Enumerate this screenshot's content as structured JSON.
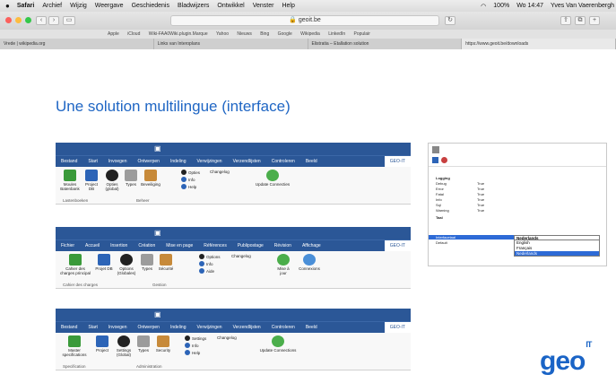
{
  "menubar": {
    "apple": "",
    "items": [
      "Safari",
      "Archief",
      "Wijzig",
      "Weergave",
      "Geschiedenis",
      "Bladwijzers",
      "Ontwikkel",
      "Venster",
      "Help"
    ],
    "status": "100%",
    "clock": "Wo 14:47",
    "user": "Yves Van Vaerenbergh"
  },
  "browser": {
    "address": "🔒 geoit.be",
    "favorites": [
      "Apple",
      "iCloud",
      "Wiki-FAA0Wiki.plugin.Marque",
      "Yahoo",
      "Nieuws",
      "Bing",
      "Google",
      "Wikipedia",
      "LinkedIn",
      "Populair"
    ],
    "tabs": [
      "Vrede | wikipedia.org",
      "Links van Interoplans",
      "Elistratia – Etallation solution",
      "https://www.geoit.be/downloads"
    ]
  },
  "slide": {
    "title": "Une solution multilingue (interface)"
  },
  "ribbons": [
    {
      "tabs": [
        "Bestand",
        "Start",
        "Invoegen",
        "Ontwerpen",
        "Indeling",
        "Verwijzingen",
        "Verzendlijsten",
        "Controleren",
        "Beeld",
        "GEO-IT"
      ],
      "buttons": [
        "Moules Batenbank",
        "Project DB",
        "Opties (global)",
        "Types",
        "Beveiliging"
      ],
      "small": [
        "Opties",
        "Changelog",
        "Info",
        "Help",
        "Update Connecties"
      ],
      "groups": [
        "Lastenboeken",
        "Beheer"
      ]
    },
    {
      "tabs": [
        "Fichier",
        "Accueil",
        "Insertion",
        "Création",
        "Mise en page",
        "Références",
        "Publipostage",
        "Révision",
        "Affichage",
        "GEO-IT"
      ],
      "buttons": [
        "Cahier des charges principal",
        "Projet DB",
        "Options (Globales)",
        "Types",
        "Sécurité"
      ],
      "small": [
        "Options",
        "Changelog",
        "Info",
        "Aide",
        "Mise à jour",
        "Connexions"
      ],
      "groups": [
        "Cahier des charges",
        "Gestion"
      ]
    },
    {
      "tabs": [
        "Bestand",
        "Start",
        "Invoegen",
        "Ontwerpen",
        "Indeling",
        "Verwijzingen",
        "Verzendlijsten",
        "Controleren",
        "Beeld",
        "GEO-IT"
      ],
      "buttons": [
        "Master specifications",
        "Project",
        "Settings (Global)",
        "Types",
        "Security"
      ],
      "small": [
        "Settings",
        "Changelog",
        "Info",
        "Help",
        "Update Connections"
      ],
      "groups": [
        "Specification",
        "Administration"
      ]
    }
  ],
  "properties": {
    "rows": [
      {
        "k": "Logging",
        "v": ""
      },
      {
        "k": "Debug",
        "v": "True"
      },
      {
        "k": "Error",
        "v": "True"
      },
      {
        "k": "Fatal",
        "v": "True"
      },
      {
        "k": "Info",
        "v": "True"
      },
      {
        "k": "Sql",
        "v": "True"
      },
      {
        "k": "Warning",
        "v": "True"
      },
      {
        "k": "Taal",
        "v": ""
      },
      {
        "k": "Interfacetaal",
        "v": ""
      },
      {
        "k": "Default",
        "v": ""
      }
    ],
    "dropdown": {
      "selected": "Nederlands",
      "options": [
        "English",
        "Français",
        "Nederlands"
      ]
    }
  },
  "logo": {
    "text": "geo",
    "sup": "IT"
  },
  "colors": {
    "ribbon": "#2b5797",
    "title": "#1f66c4",
    "logo": "#1a64c6"
  }
}
